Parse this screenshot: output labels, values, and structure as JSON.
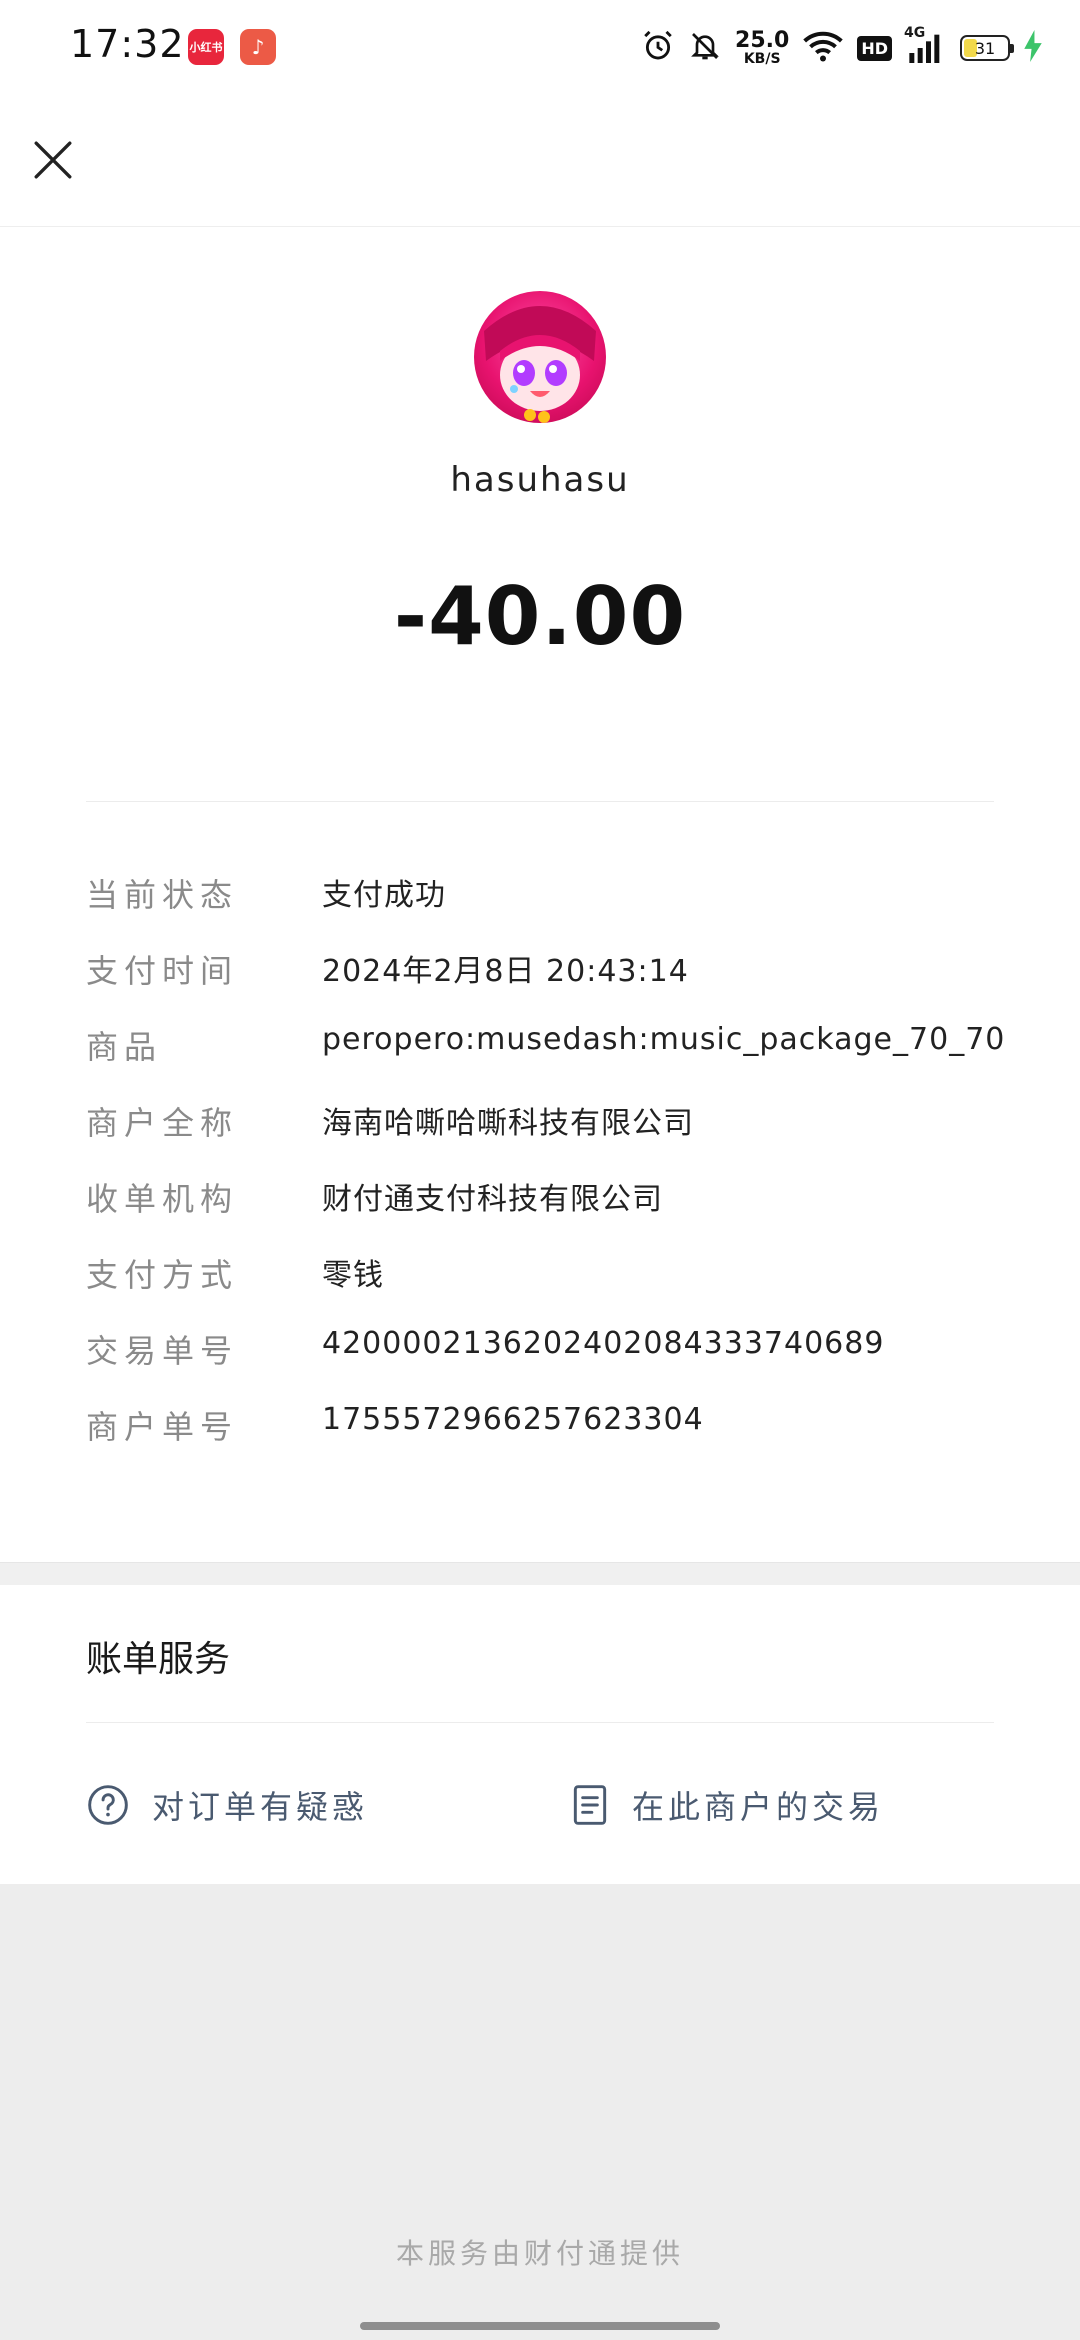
{
  "status_bar": {
    "time": "17:32",
    "app1_label": "小红书",
    "app2_icon": "music-note-icon",
    "net_speed_value": "25.0",
    "net_speed_unit": "KB/S",
    "network_type": "4G",
    "hd_label": "HD",
    "battery_level": "31"
  },
  "header": {
    "close_icon": "close-icon"
  },
  "payee": {
    "name": "hasuhasu",
    "amount": "-40.00"
  },
  "details": [
    {
      "label": "当前状态",
      "value": "支付成功"
    },
    {
      "label": "支付时间",
      "value": "2024年2月8日 20:43:14"
    },
    {
      "label": "商品",
      "value": "peropero:musedash:music_package_70_70"
    },
    {
      "label": "商户全称",
      "value": "海南哈嘶哈嘶科技有限公司"
    },
    {
      "label": "收单机构",
      "value": "财付通支付科技有限公司"
    },
    {
      "label": "支付方式",
      "value": "零钱"
    },
    {
      "label": "交易单号",
      "value": "4200002136202402084333740689"
    },
    {
      "label": "商户单号",
      "value": "1755572966257623304"
    }
  ],
  "service": {
    "title": "账单服务",
    "order_question": "对订单有疑惑",
    "merchant_transactions": "在此商户的交易"
  },
  "footer": {
    "text": "本服务由财付通提供"
  },
  "colors": {
    "accent_link": "#4a5a70",
    "avatar_pink": "#e8136f"
  }
}
